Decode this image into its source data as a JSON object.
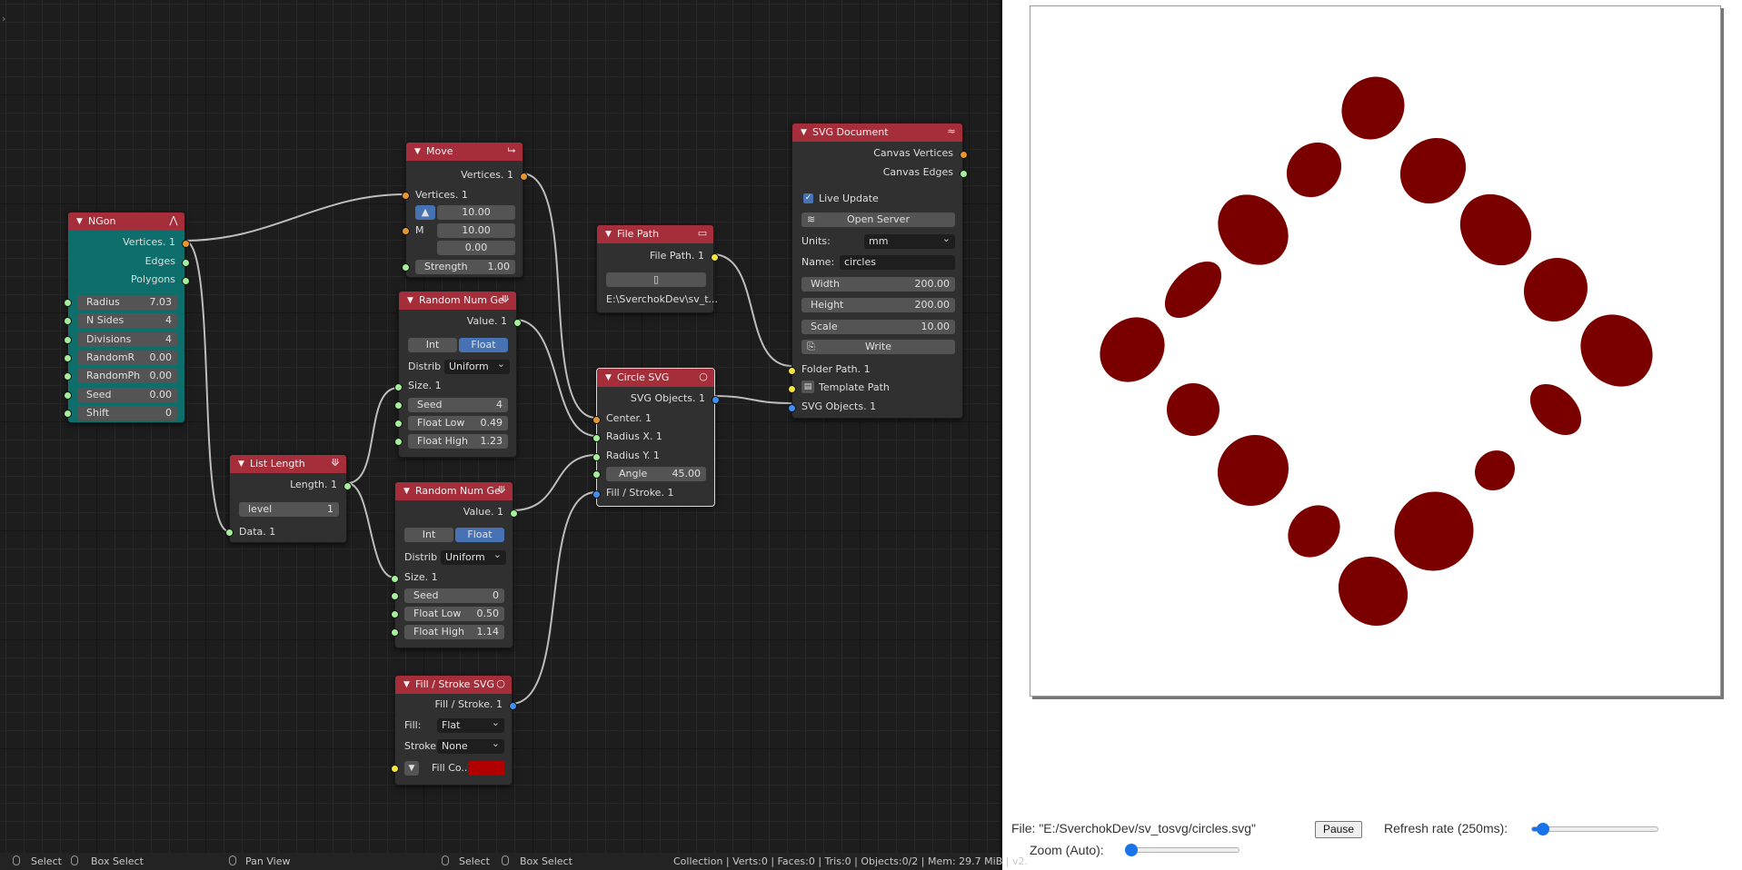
{
  "nodes": {
    "ngon": {
      "title": "NGon",
      "outputs": [
        "Vertices. 1",
        "Edges",
        "Polygons"
      ],
      "params": [
        {
          "label": "Radius",
          "value": "7.03"
        },
        {
          "label": "N Sides",
          "value": "4"
        },
        {
          "label": "Divisions",
          "value": "4"
        },
        {
          "label": "RandomR",
          "value": "0.00"
        },
        {
          "label": "RandomPh",
          "value": "0.00"
        },
        {
          "label": "Seed",
          "value": "0.00"
        },
        {
          "label": "Shift",
          "value": "0"
        }
      ]
    },
    "move": {
      "title": "Move",
      "output": "Vertices. 1",
      "input": "Vertices. 1",
      "vector": [
        "10.00",
        "10.00",
        "0.00"
      ],
      "m_label": "M",
      "strength_label": "Strength",
      "strength_value": "1.00"
    },
    "file_path": {
      "title": "File Path",
      "output": "File Path. 1",
      "path": "E:\\SverchokDev\\sv_t..."
    },
    "random1": {
      "title": "Random Num Ge",
      "output": "Value. 1",
      "modes": [
        "Int",
        "Float"
      ],
      "active_mode": "Float",
      "distrib_label": "Distrib",
      "distrib_value": "Uniform",
      "size_label": "Size. 1",
      "params": [
        {
          "label": "Seed",
          "value": "4"
        },
        {
          "label": "Float Low",
          "value": "0.49"
        },
        {
          "label": "Float High",
          "value": "1.23"
        }
      ]
    },
    "random2": {
      "title": "Random Num Ge",
      "output": "Value. 1",
      "modes": [
        "Int",
        "Float"
      ],
      "active_mode": "Float",
      "distrib_label": "Distrib",
      "distrib_value": "Uniform",
      "size_label": "Size. 1",
      "params": [
        {
          "label": "Seed",
          "value": "0"
        },
        {
          "label": "Float Low",
          "value": "0.50"
        },
        {
          "label": "Float High",
          "value": "1.14"
        }
      ]
    },
    "list_length": {
      "title": "List Length",
      "output": "Length. 1",
      "level_label": "level",
      "level_value": "1",
      "input": "Data. 1"
    },
    "circle_svg": {
      "title": "Circle SVG",
      "output": "SVG Objects. 1",
      "inputs": [
        "Center. 1",
        "Radius X. 1",
        "Radius Y. 1"
      ],
      "angle_label": "Angle",
      "angle_value": "45.00",
      "fill_input": "Fill / Stroke. 1"
    },
    "fill_stroke": {
      "title": "Fill / Stroke SVG",
      "output": "Fill / Stroke. 1",
      "fill_label": "Fill:",
      "fill_value": "Flat",
      "stroke_label": "Stroke:",
      "stroke_value": "None",
      "fill_color_label": "Fill Co...",
      "fill_color": "#b00000"
    },
    "svg_document": {
      "title": "SVG Document",
      "outputs": [
        "Canvas Vertices",
        "Canvas Edges"
      ],
      "live_update_label": "Live Update",
      "live_update": true,
      "open_server_label": "Open Server",
      "units_label": "Units:",
      "units_value": "mm",
      "name_label": "Name:",
      "name_value": "circles",
      "width_label": "Width",
      "width_value": "200.00",
      "height_label": "Height",
      "height_value": "200.00",
      "scale_label": "Scale",
      "scale_value": "10.00",
      "write_label": "Write",
      "inputs": [
        "Folder Path. 1",
        "Template Path",
        "SVG Objects. 1"
      ]
    }
  },
  "statusbar": {
    "select": "Select",
    "box_select": "Box Select",
    "pan_view": "Pan View",
    "select2": "Select",
    "box_select2": "Box Select",
    "info": "Collection | Verts:0 | Faces:0 | Tris:0 | Objects:0/2 | Mem: 29.7 MiB | v2."
  },
  "viewer": {
    "file_text": "File: \"E:/SverchokDev/sv_tosvg/circles.svg\"",
    "pause_label": "Pause",
    "refresh_label": "Refresh rate (250ms):",
    "refresh_level": 0.05,
    "zoom_label": "Zoom (Auto):",
    "zoom_level": 0.0,
    "ellipse_color": "#7a0000"
  }
}
